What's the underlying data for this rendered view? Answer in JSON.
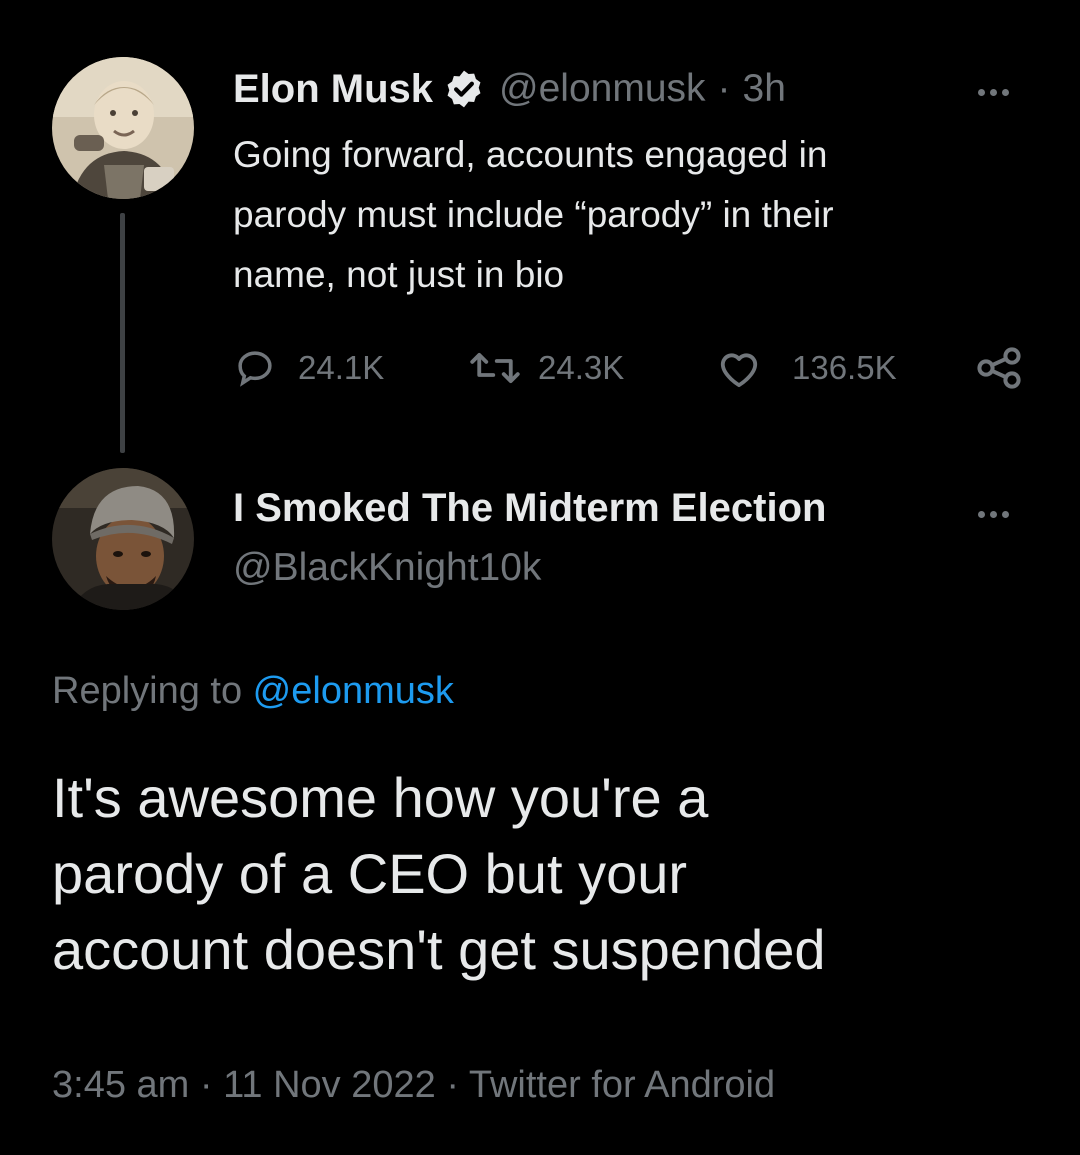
{
  "original_tweet": {
    "author_name": "Elon Musk",
    "author_handle": "@elonmusk",
    "separator": "·",
    "time_ago": "3h",
    "text_lines": [
      "Going forward, accounts engaged in",
      "parody must include “parody” in their",
      "name, not just in bio"
    ],
    "stats": {
      "replies": "24.1K",
      "retweets": "24.3K",
      "likes": "136.5K"
    }
  },
  "reply_tweet": {
    "author_name": "I Smoked The Midterm Election",
    "author_handle": "@BlackKnight10k",
    "replying_prefix": "Replying to ",
    "replying_to": "@elonmusk",
    "text_lines": [
      "It's awesome how you're a",
      "parody of a CEO but your",
      "account doesn't get suspended"
    ],
    "timestamp": "3:45 am",
    "date": "11 Nov 2022",
    "source": "Twitter for Android",
    "separator": "·"
  },
  "colors": {
    "background": "#000000",
    "text": "#e7e9ea",
    "secondary": "#71767b",
    "accent": "#1d9bf0"
  },
  "icons": [
    "verified-badge-icon",
    "more-icon",
    "reply-icon",
    "retweet-icon",
    "like-icon",
    "share-icon"
  ]
}
